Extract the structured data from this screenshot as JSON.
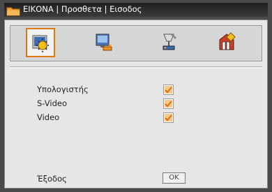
{
  "window": {
    "title": "ΕΙΚΟΝΑ | Προσθετα | Εισοδος"
  },
  "tabs": [
    {
      "icon": "image-settings-icon",
      "selected": true
    },
    {
      "icon": "display-settings-icon",
      "selected": false
    },
    {
      "icon": "setup-settings-icon",
      "selected": false
    },
    {
      "icon": "options-settings-icon",
      "selected": false
    }
  ],
  "inputs": [
    {
      "label": "Υπολογιστής",
      "checked": true
    },
    {
      "label": "S-Video",
      "checked": true
    },
    {
      "label": "Video",
      "checked": true
    }
  ],
  "exit": {
    "label": "Έξοδος",
    "button": "OK"
  },
  "colors": {
    "accent": "#e07810",
    "check": "#e8902a",
    "panel": "#e6e6e6",
    "frame": "#4a4a4a"
  }
}
